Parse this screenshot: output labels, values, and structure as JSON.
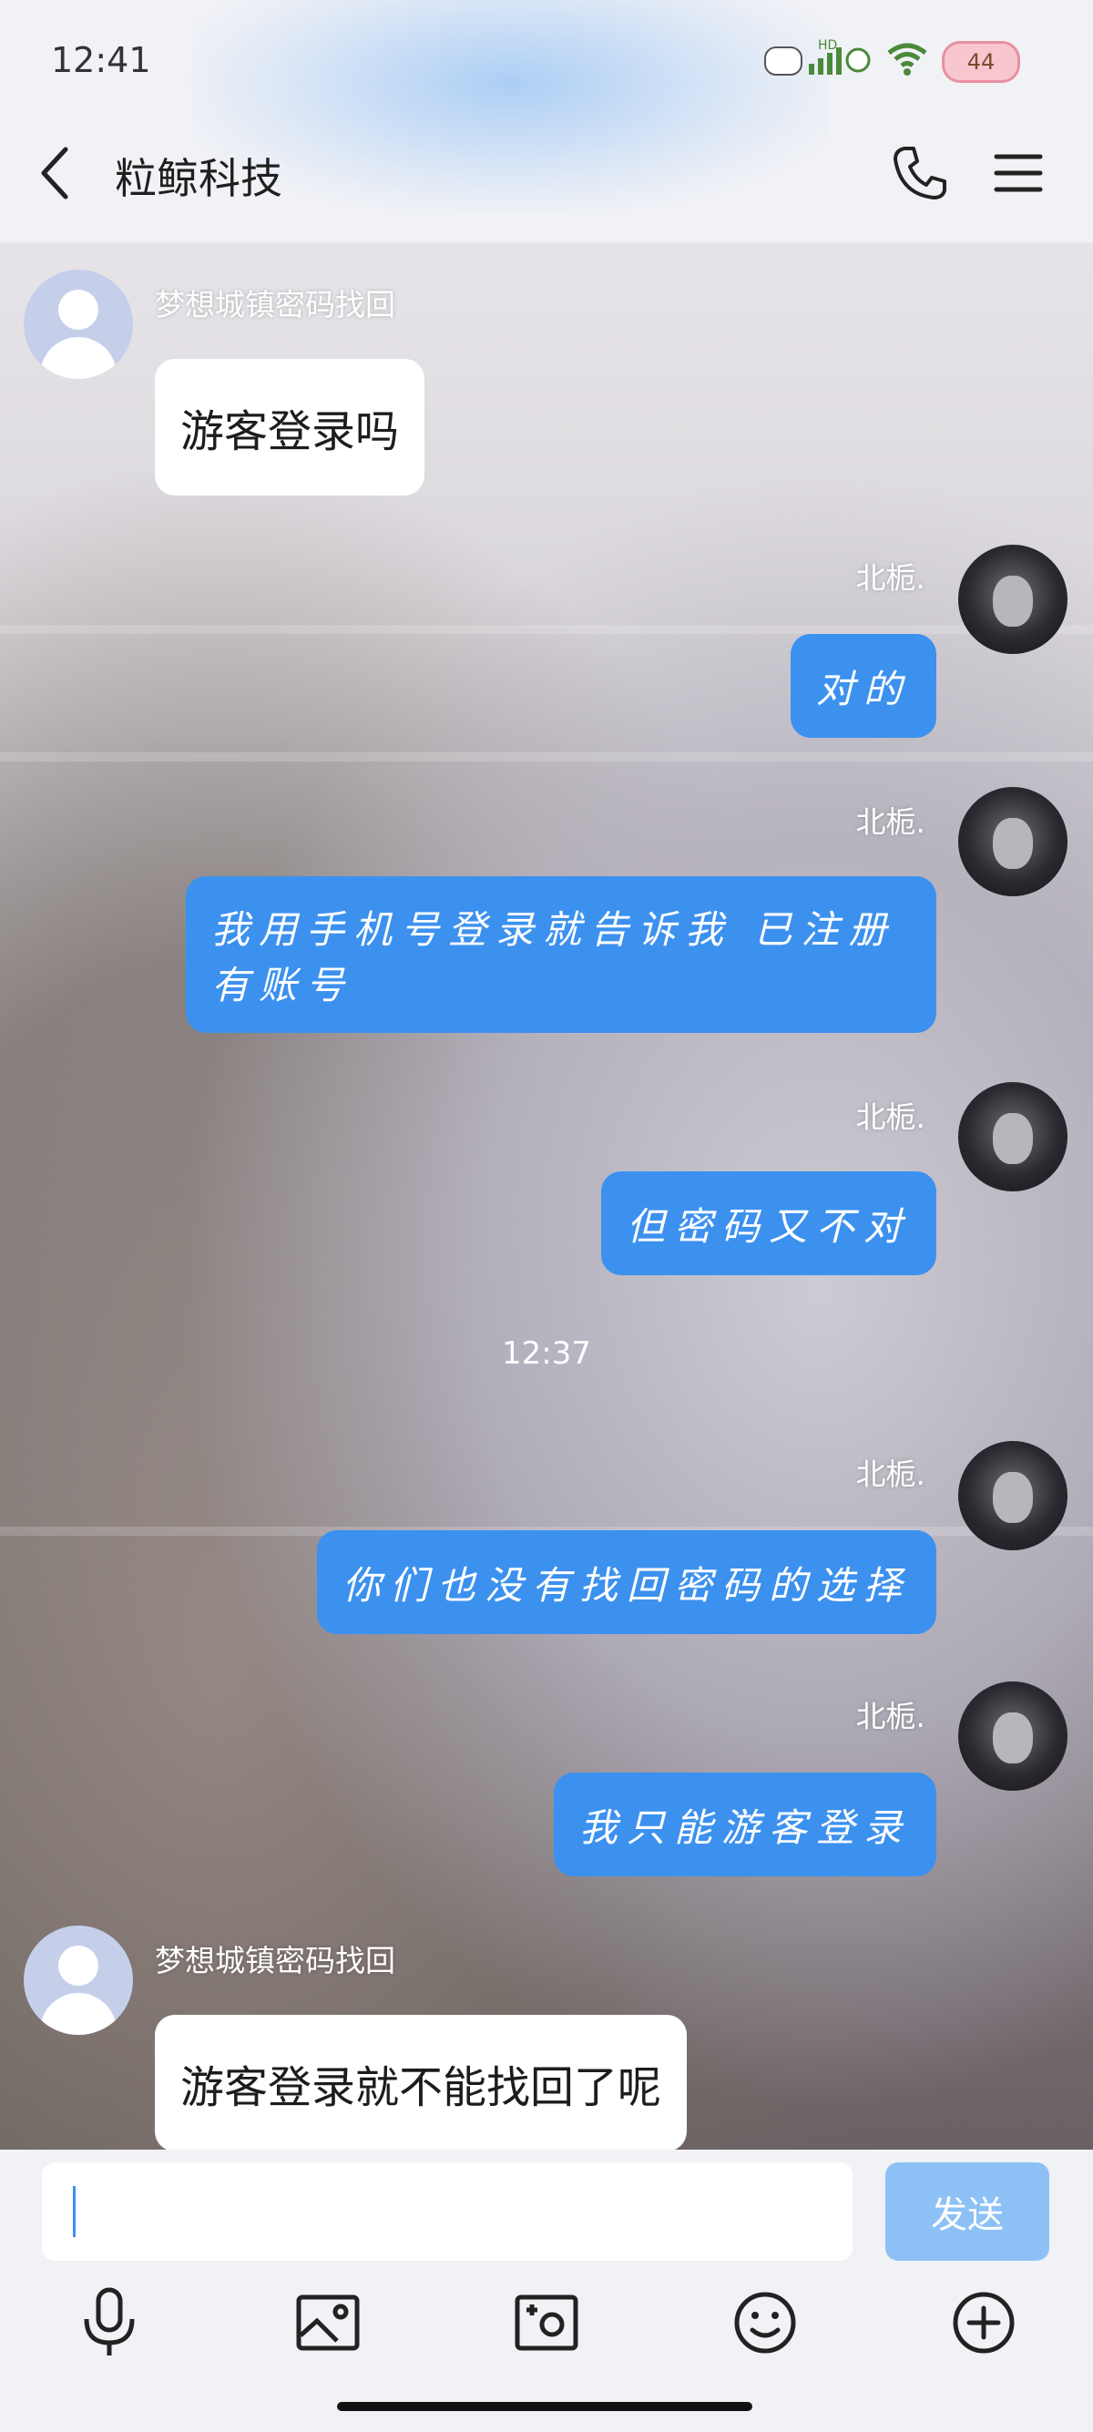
{
  "status_bar": {
    "time": "12:41",
    "battery": "44",
    "icons": [
      "hd-signal-icon",
      "wifi-icon",
      "battery-icon"
    ]
  },
  "header": {
    "title": "粒鲸科技",
    "back_icon": "chevron-left-icon",
    "phone_icon": "phone-icon",
    "menu_icon": "menu-icon"
  },
  "messages": [
    {
      "side": "left",
      "sender": "梦想城镇密码找回",
      "text": "游客登录吗"
    },
    {
      "side": "right",
      "sender": "北栀.",
      "text": "对的"
    },
    {
      "side": "right",
      "sender": "北栀.",
      "text_line1": "我用手机号登录就告诉我 已注册",
      "text_line2": "有账号"
    },
    {
      "side": "right",
      "sender": "北栀.",
      "text": "但密码又不对"
    },
    {
      "divider": "12:37"
    },
    {
      "side": "right",
      "sender": "北栀.",
      "text": "你们也没有找回密码的选择"
    },
    {
      "side": "right",
      "sender": "北栀.",
      "text": "我只能游客登录"
    },
    {
      "side": "left",
      "sender": "梦想城镇密码找回",
      "text": "游客登录就不能找回了呢"
    }
  ],
  "input": {
    "value": "",
    "send_label": "发送"
  },
  "toolbar": [
    "microphone-icon",
    "image-icon",
    "camera-icon",
    "emoji-icon",
    "plus-icon"
  ],
  "colors": {
    "bubble_sent": "#3c91ef",
    "bubble_received": "#ffffff",
    "send_button": "#8dc1f6"
  }
}
